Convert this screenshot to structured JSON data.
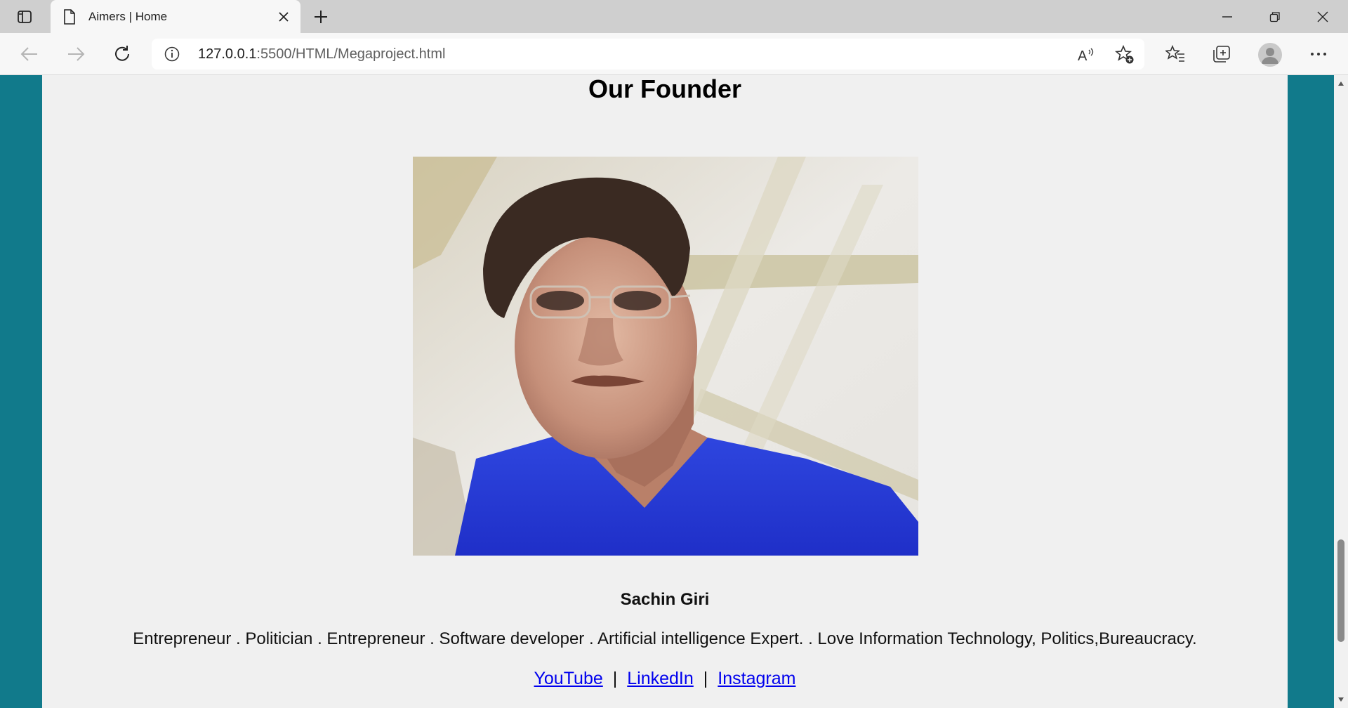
{
  "browser": {
    "tab_title": "Aimers | Home",
    "url_host": "127.0.0.1",
    "url_rest": ":5500/HTML/Megaproject.html"
  },
  "page": {
    "heading": "Our Founder",
    "founder_name": "Sachin Giri",
    "description": "Entrepreneur . Politician . Entrepreneur . Software developer . Artificial intelligence Expert. . Love Information Technology, Politics,Bureaucracy.",
    "links": [
      {
        "label": "YouTube"
      },
      {
        "label": "LinkedIn"
      },
      {
        "label": "Instagram"
      }
    ],
    "separator": "|"
  },
  "colors": {
    "page_side_background": "#117a8b",
    "content_background": "#f0f0f0",
    "link": "#0000ee"
  },
  "icons": {
    "tab_actions": "tab-actions-icon",
    "page": "page-icon",
    "close": "close-icon",
    "new_tab": "plus-icon",
    "back": "back-arrow-icon",
    "forward": "forward-arrow-icon",
    "refresh": "refresh-icon",
    "site_info": "info-icon",
    "read_aloud": "read-aloud-icon",
    "add_favorite": "star-plus-icon",
    "favorites": "favorites-icon",
    "collections": "collections-icon",
    "profile": "profile-icon",
    "more": "more-icon"
  }
}
